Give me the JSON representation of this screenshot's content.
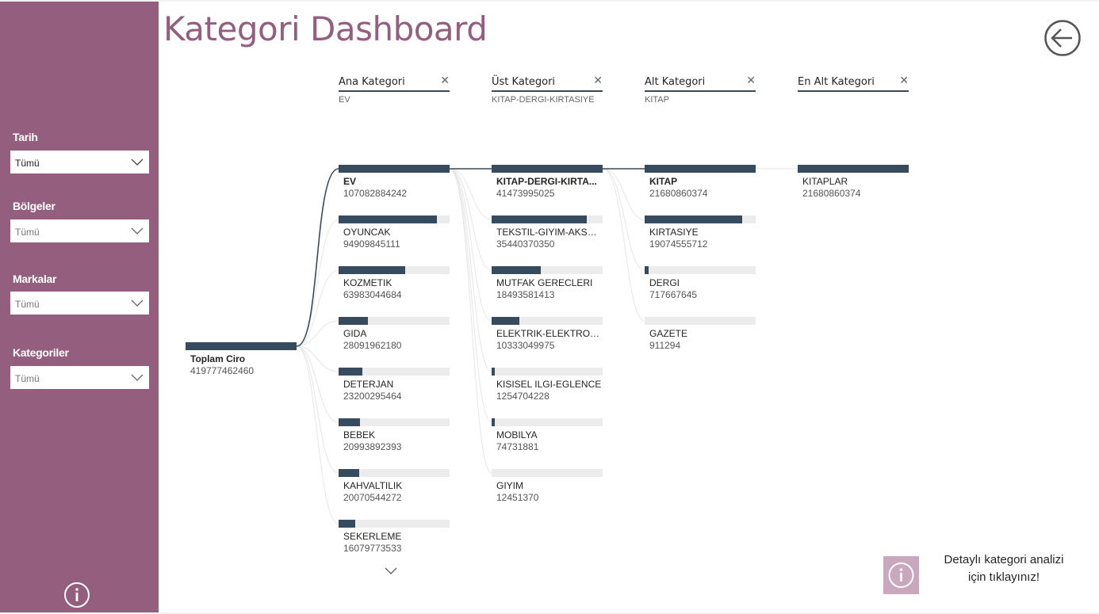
{
  "title": "Kategori Dashboard",
  "filters": [
    {
      "label": "Tarih",
      "value": "Tümü"
    },
    {
      "label": "Bölgeler",
      "value": "Tümü"
    },
    {
      "label": "Markalar",
      "value": "Tümü"
    },
    {
      "label": "Kategoriler",
      "value": "Tümü"
    }
  ],
  "levels": [
    {
      "name": "Ana Kategori",
      "selected": "EV"
    },
    {
      "name": "Üst Kategori",
      "selected": "KITAP-DERGI-KIRTASIYE"
    },
    {
      "name": "Alt Kategori",
      "selected": "KITAP"
    },
    {
      "name": "En Alt Kategori",
      "selected": ""
    }
  ],
  "root": {
    "label": "Toplam Ciro",
    "value": "419777462460",
    "fill": 1.0
  },
  "ana_kategori": [
    {
      "label": "EV",
      "value": "107082884242",
      "fill": 1.0,
      "selected": true
    },
    {
      "label": "OYUNCAK",
      "value": "94909845111",
      "fill": 0.886
    },
    {
      "label": "KOZMETIK",
      "value": "63983044684",
      "fill": 0.598
    },
    {
      "label": "GIDA",
      "value": "28091962180",
      "fill": 0.262
    },
    {
      "label": "DETERJAN",
      "value": "23200295464",
      "fill": 0.217
    },
    {
      "label": "BEBEK",
      "value": "20993892393",
      "fill": 0.196
    },
    {
      "label": "KAHVALTILIK",
      "value": "20070544272",
      "fill": 0.187
    },
    {
      "label": "SEKERLEME",
      "value": "16079773533",
      "fill": 0.15
    }
  ],
  "ust_kategori": [
    {
      "label": "KITAP-DERGI-KIRTA...",
      "value": "41473995025",
      "fill": 1.0,
      "selected": true
    },
    {
      "label": "TEKSTIL-GIYIM-AKSES...",
      "value": "35440370350",
      "fill": 0.855
    },
    {
      "label": "MUTFAK GERECLERI",
      "value": "18493581413",
      "fill": 0.446
    },
    {
      "label": "ELEKTRIK-ELEKTRONIK",
      "value": "10333049975",
      "fill": 0.249
    },
    {
      "label": "KISISEL ILGI-EGLENCE",
      "value": "1254704228",
      "fill": 0.03
    },
    {
      "label": "MOBILYA",
      "value": "74731881",
      "fill": 0.002
    },
    {
      "label": "GIYIM",
      "value": "12451370",
      "fill": 0.0003
    }
  ],
  "alt_kategori": [
    {
      "label": "KITAP",
      "value": "21680860374",
      "fill": 1.0,
      "selected": true
    },
    {
      "label": "KIRTASIYE",
      "value": "19074555712",
      "fill": 0.88
    },
    {
      "label": "DERGI",
      "value": "717667645",
      "fill": 0.033
    },
    {
      "label": "GAZETE",
      "value": "911294",
      "fill": 4e-05
    }
  ],
  "en_alt_kategori": [
    {
      "label": "KITAPLAR",
      "value": "21680860374",
      "fill": 1.0
    }
  ],
  "detail_cta": {
    "line1": "Detaylı kategori analizi",
    "line2": "için tıklayınız!"
  },
  "colors": {
    "sidebar": "#945f7e",
    "title": "#945f7e",
    "bar": "#364b5d",
    "track": "#ececec",
    "cta": "#c9a7bc"
  }
}
